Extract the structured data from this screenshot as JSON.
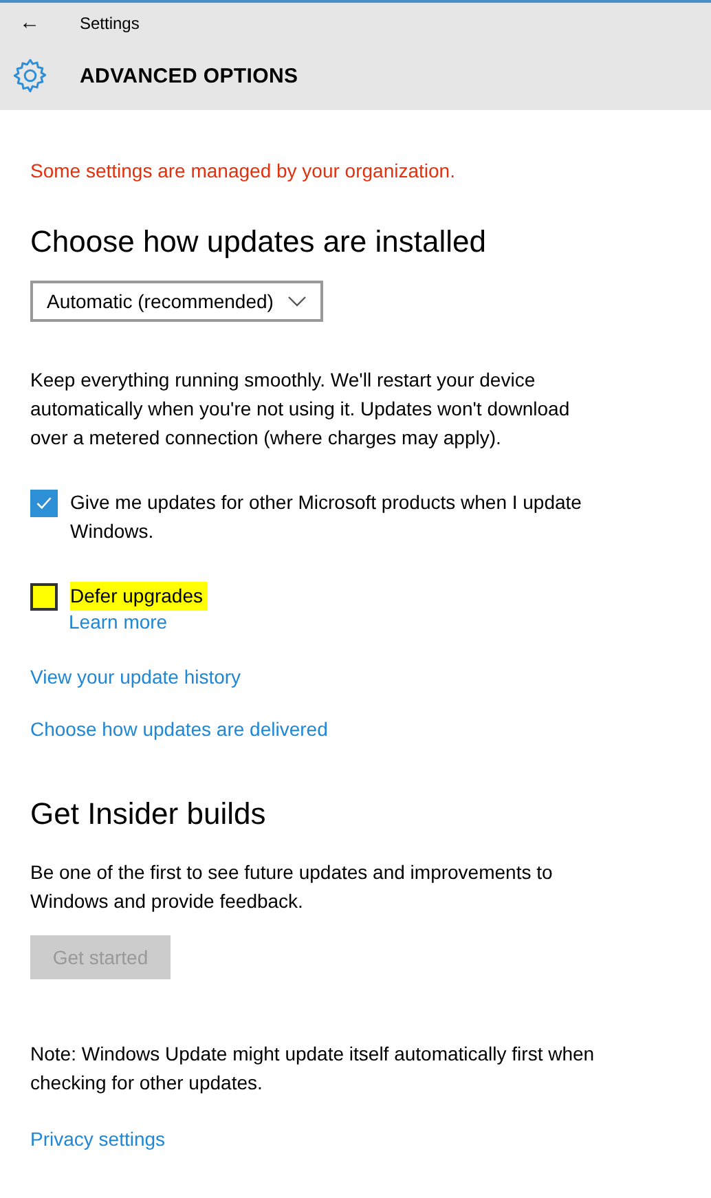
{
  "window": {
    "title": "Settings",
    "back_icon": "←"
  },
  "header": {
    "title": "ADVANCED OPTIONS"
  },
  "notice": "Some settings are managed by your organization.",
  "install_section": {
    "heading": "Choose how updates are installed",
    "dropdown": {
      "value": "Automatic (recommended)"
    },
    "description": "Keep everything running smoothly. We'll restart your device automatically when you're not using it. Updates won't download over a metered connection (where charges may apply)."
  },
  "options": [
    {
      "label": "Give me updates for other Microsoft products when I update Windows.",
      "checked": true,
      "highlighted": false
    },
    {
      "label": "Defer upgrades",
      "checked": false,
      "highlighted": true,
      "link": "Learn more"
    }
  ],
  "links": [
    "View your update history",
    "Choose how updates are delivered"
  ],
  "insider": {
    "heading": "Get Insider builds",
    "description": "Be one of the first to see future updates and improvements to Windows and provide feedback.",
    "button": {
      "label": "Get started",
      "disabled": true
    }
  },
  "note": "Note: Windows Update might update itself automatically first when checking for other updates.",
  "footer_link": "Privacy settings"
}
